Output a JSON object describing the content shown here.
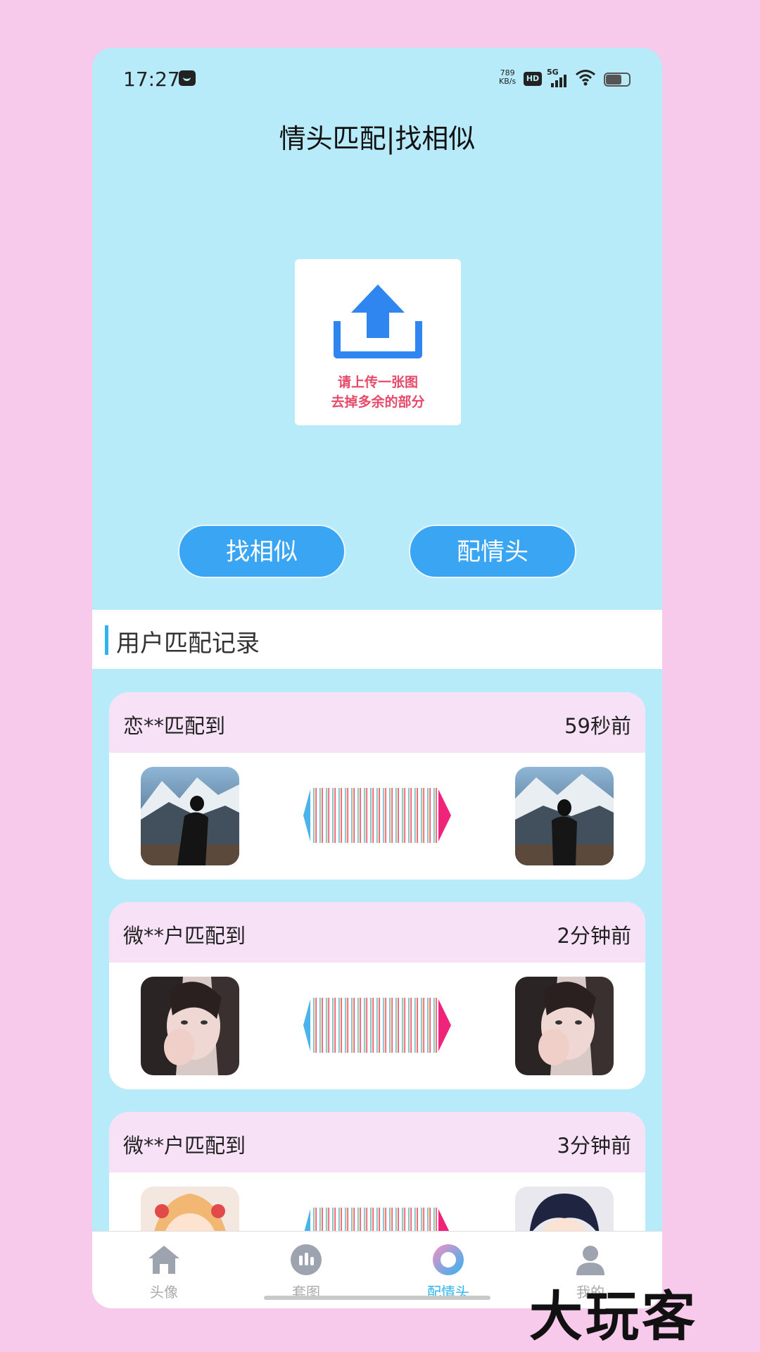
{
  "status": {
    "time": "17:27",
    "speed": "789\nKB/s",
    "hd": "HD",
    "network": "5G"
  },
  "page_title": "情头匹配|找相似",
  "upload": {
    "line1": "请上传一张图",
    "line2": "去掉多余的部分"
  },
  "buttons": {
    "find_similar": "找相似",
    "match_couple": "配情头"
  },
  "records": {
    "header": "用户匹配记录",
    "items": [
      {
        "who": "恋**匹配到",
        "when": "59秒前"
      },
      {
        "who": "微**户匹配到",
        "when": "2分钟前"
      },
      {
        "who": "微**户匹配到",
        "when": "3分钟前"
      }
    ]
  },
  "tabs": [
    {
      "label": "头像",
      "icon": "home-icon"
    },
    {
      "label": "套图",
      "icon": "album-icon"
    },
    {
      "label": "配情头",
      "icon": "match-icon"
    },
    {
      "label": "我的",
      "icon": "user-icon"
    }
  ],
  "watermark": "大玩客",
  "colors": {
    "accent": "#3aa5f2",
    "page_bg": "#f7c9ea",
    "phone_bg": "#b8ebfa",
    "hint": "#e74a6a"
  }
}
